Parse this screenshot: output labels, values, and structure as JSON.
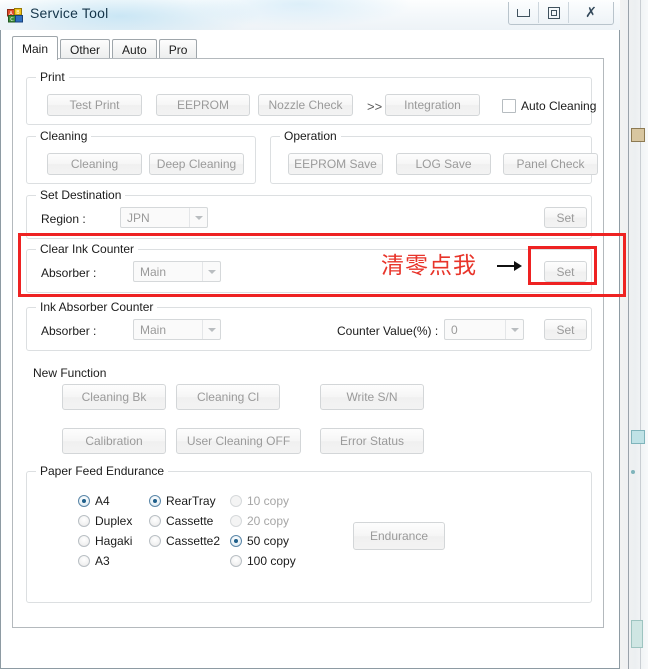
{
  "window": {
    "title": "Service Tool",
    "icon": "abc-blocks-icon",
    "buttons": {
      "minimize": "Minimize",
      "maximize": "Maximize",
      "close": "Close"
    }
  },
  "tabs": [
    {
      "label": "Main",
      "active": true
    },
    {
      "label": "Other",
      "active": false
    },
    {
      "label": "Auto",
      "active": false
    },
    {
      "label": "Pro",
      "active": false
    }
  ],
  "groups": {
    "print": {
      "legend": "Print",
      "buttons": [
        {
          "label": "Test Print"
        },
        {
          "label": "EEPROM"
        },
        {
          "label": "Nozzle Check"
        },
        {
          "label": "Integration"
        }
      ],
      "separator": ">>",
      "checkbox": {
        "label": "Auto Cleaning",
        "checked": false
      }
    },
    "cleaning": {
      "legend": "Cleaning",
      "buttons": [
        {
          "label": "Cleaning"
        },
        {
          "label": "Deep Cleaning"
        }
      ]
    },
    "operation": {
      "legend": "Operation",
      "buttons": [
        {
          "label": "EEPROM Save"
        },
        {
          "label": "LOG Save"
        },
        {
          "label": "Panel Check"
        }
      ]
    },
    "set_destination": {
      "legend": "Set Destination",
      "region_label": "Region :",
      "region_value": "JPN",
      "set_label": "Set"
    },
    "clear_ink_counter": {
      "legend": "Clear Ink Counter",
      "absorber_label": "Absorber :",
      "absorber_value": "Main",
      "set_label": "Set"
    },
    "ink_absorber_counter": {
      "legend": "Ink Absorber Counter",
      "absorber_label": "Absorber :",
      "absorber_value": "Main",
      "counter_label": "Counter Value(%) :",
      "counter_value": "0",
      "set_label": "Set"
    },
    "new_function": {
      "legend": "New Function",
      "buttons": [
        {
          "label": "Cleaning Bk"
        },
        {
          "label": "Cleaning Cl"
        },
        {
          "label": "Write S/N"
        },
        {
          "label": "Calibration"
        },
        {
          "label": "User Cleaning OFF"
        },
        {
          "label": "Error Status"
        }
      ]
    },
    "paper_feed_endurance": {
      "legend": "Paper Feed Endurance",
      "paper_sizes": [
        {
          "label": "A4",
          "checked": true,
          "disabled": false
        },
        {
          "label": "Duplex",
          "checked": false,
          "disabled": false
        },
        {
          "label": "Hagaki",
          "checked": false,
          "disabled": false
        },
        {
          "label": "A3",
          "checked": false,
          "disabled": false
        }
      ],
      "sources": [
        {
          "label": "RearTray",
          "checked": true,
          "disabled": false
        },
        {
          "label": "Cassette",
          "checked": false,
          "disabled": false
        },
        {
          "label": "Cassette2",
          "checked": false,
          "disabled": false
        }
      ],
      "copies": [
        {
          "label": "10 copy",
          "checked": false,
          "disabled": true
        },
        {
          "label": "20 copy",
          "checked": false,
          "disabled": true
        },
        {
          "label": "50 copy",
          "checked": true,
          "disabled": false
        },
        {
          "label": "100 copy",
          "checked": false,
          "disabled": false
        }
      ],
      "endurance_label": "Endurance"
    }
  },
  "annotation": {
    "text": "清零点我",
    "arrow": "right-arrow-icon",
    "color": "#e8342a"
  },
  "colors": {
    "annotation_red": "#ee2222",
    "radio_selected": "#1f5f8b",
    "title_text": "#15354a"
  }
}
